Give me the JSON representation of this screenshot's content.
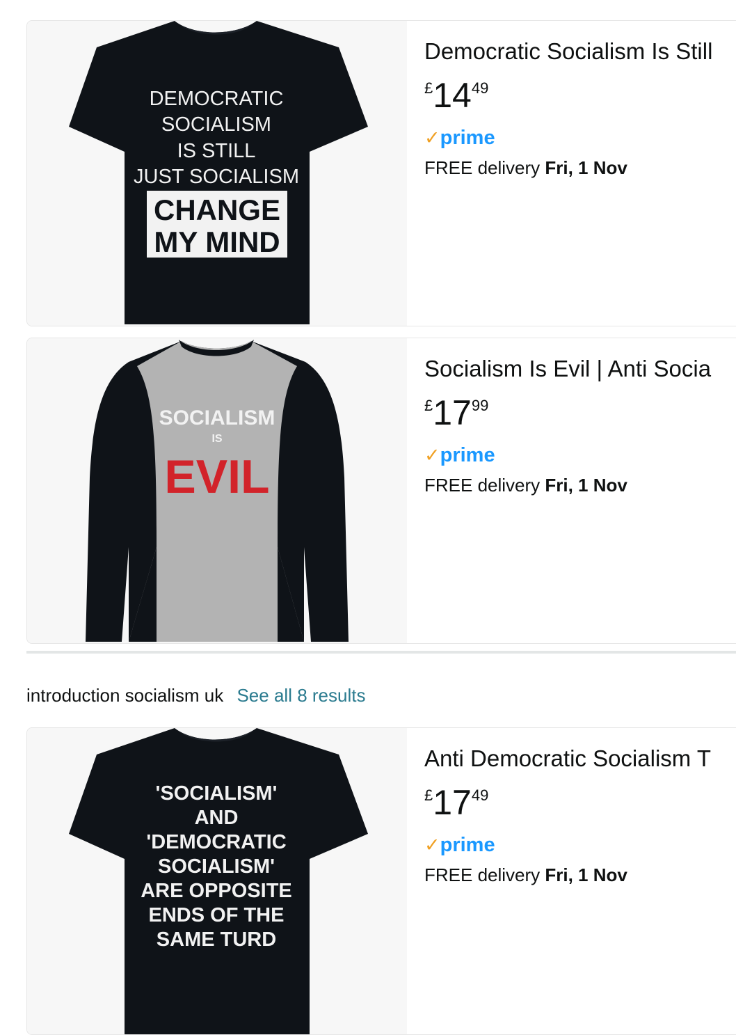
{
  "results": [
    {
      "title": "Democratic Socialism Is Still",
      "price": {
        "currency": "£",
        "whole": "14",
        "fraction": "49"
      },
      "prime_label": "prime",
      "delivery": {
        "prefix": "FREE delivery ",
        "date": "Fri, 1 Nov"
      },
      "shirt_lines": [
        "DEMOCRATIC",
        "SOCIALISM",
        "IS STILL",
        "JUST SOCIALISM"
      ],
      "shirt_box_lines": [
        "CHANGE",
        "MY MIND"
      ]
    },
    {
      "title": "Socialism Is Evil | Anti Socia",
      "price": {
        "currency": "£",
        "whole": "17",
        "fraction": "99"
      },
      "prime_label": "prime",
      "delivery": {
        "prefix": "FREE delivery ",
        "date": "Fri, 1 Nov"
      },
      "shirt_lines": [
        "SOCIALISM",
        "IS",
        "EVIL"
      ]
    }
  ],
  "section": {
    "query": "introduction socialism uk",
    "see_all": "See all 8 results"
  },
  "section_results": [
    {
      "title": "Anti Democratic Socialism T",
      "price": {
        "currency": "£",
        "whole": "17",
        "fraction": "49"
      },
      "prime_label": "prime",
      "delivery": {
        "prefix": "FREE delivery ",
        "date": "Fri, 1 Nov"
      },
      "shirt_lines": [
        "'SOCIALISM'",
        "AND",
        "'DEMOCRATIC",
        "SOCIALISM'",
        "ARE OPPOSITE",
        "ENDS OF THE",
        "SAME TURD"
      ]
    }
  ],
  "colors": {
    "prime_blue": "#1a98ff",
    "prime_check": "#f0a023",
    "link_teal": "#2b7b8f",
    "shirt_black": "#0f1318",
    "evil_red": "#d2232a"
  }
}
